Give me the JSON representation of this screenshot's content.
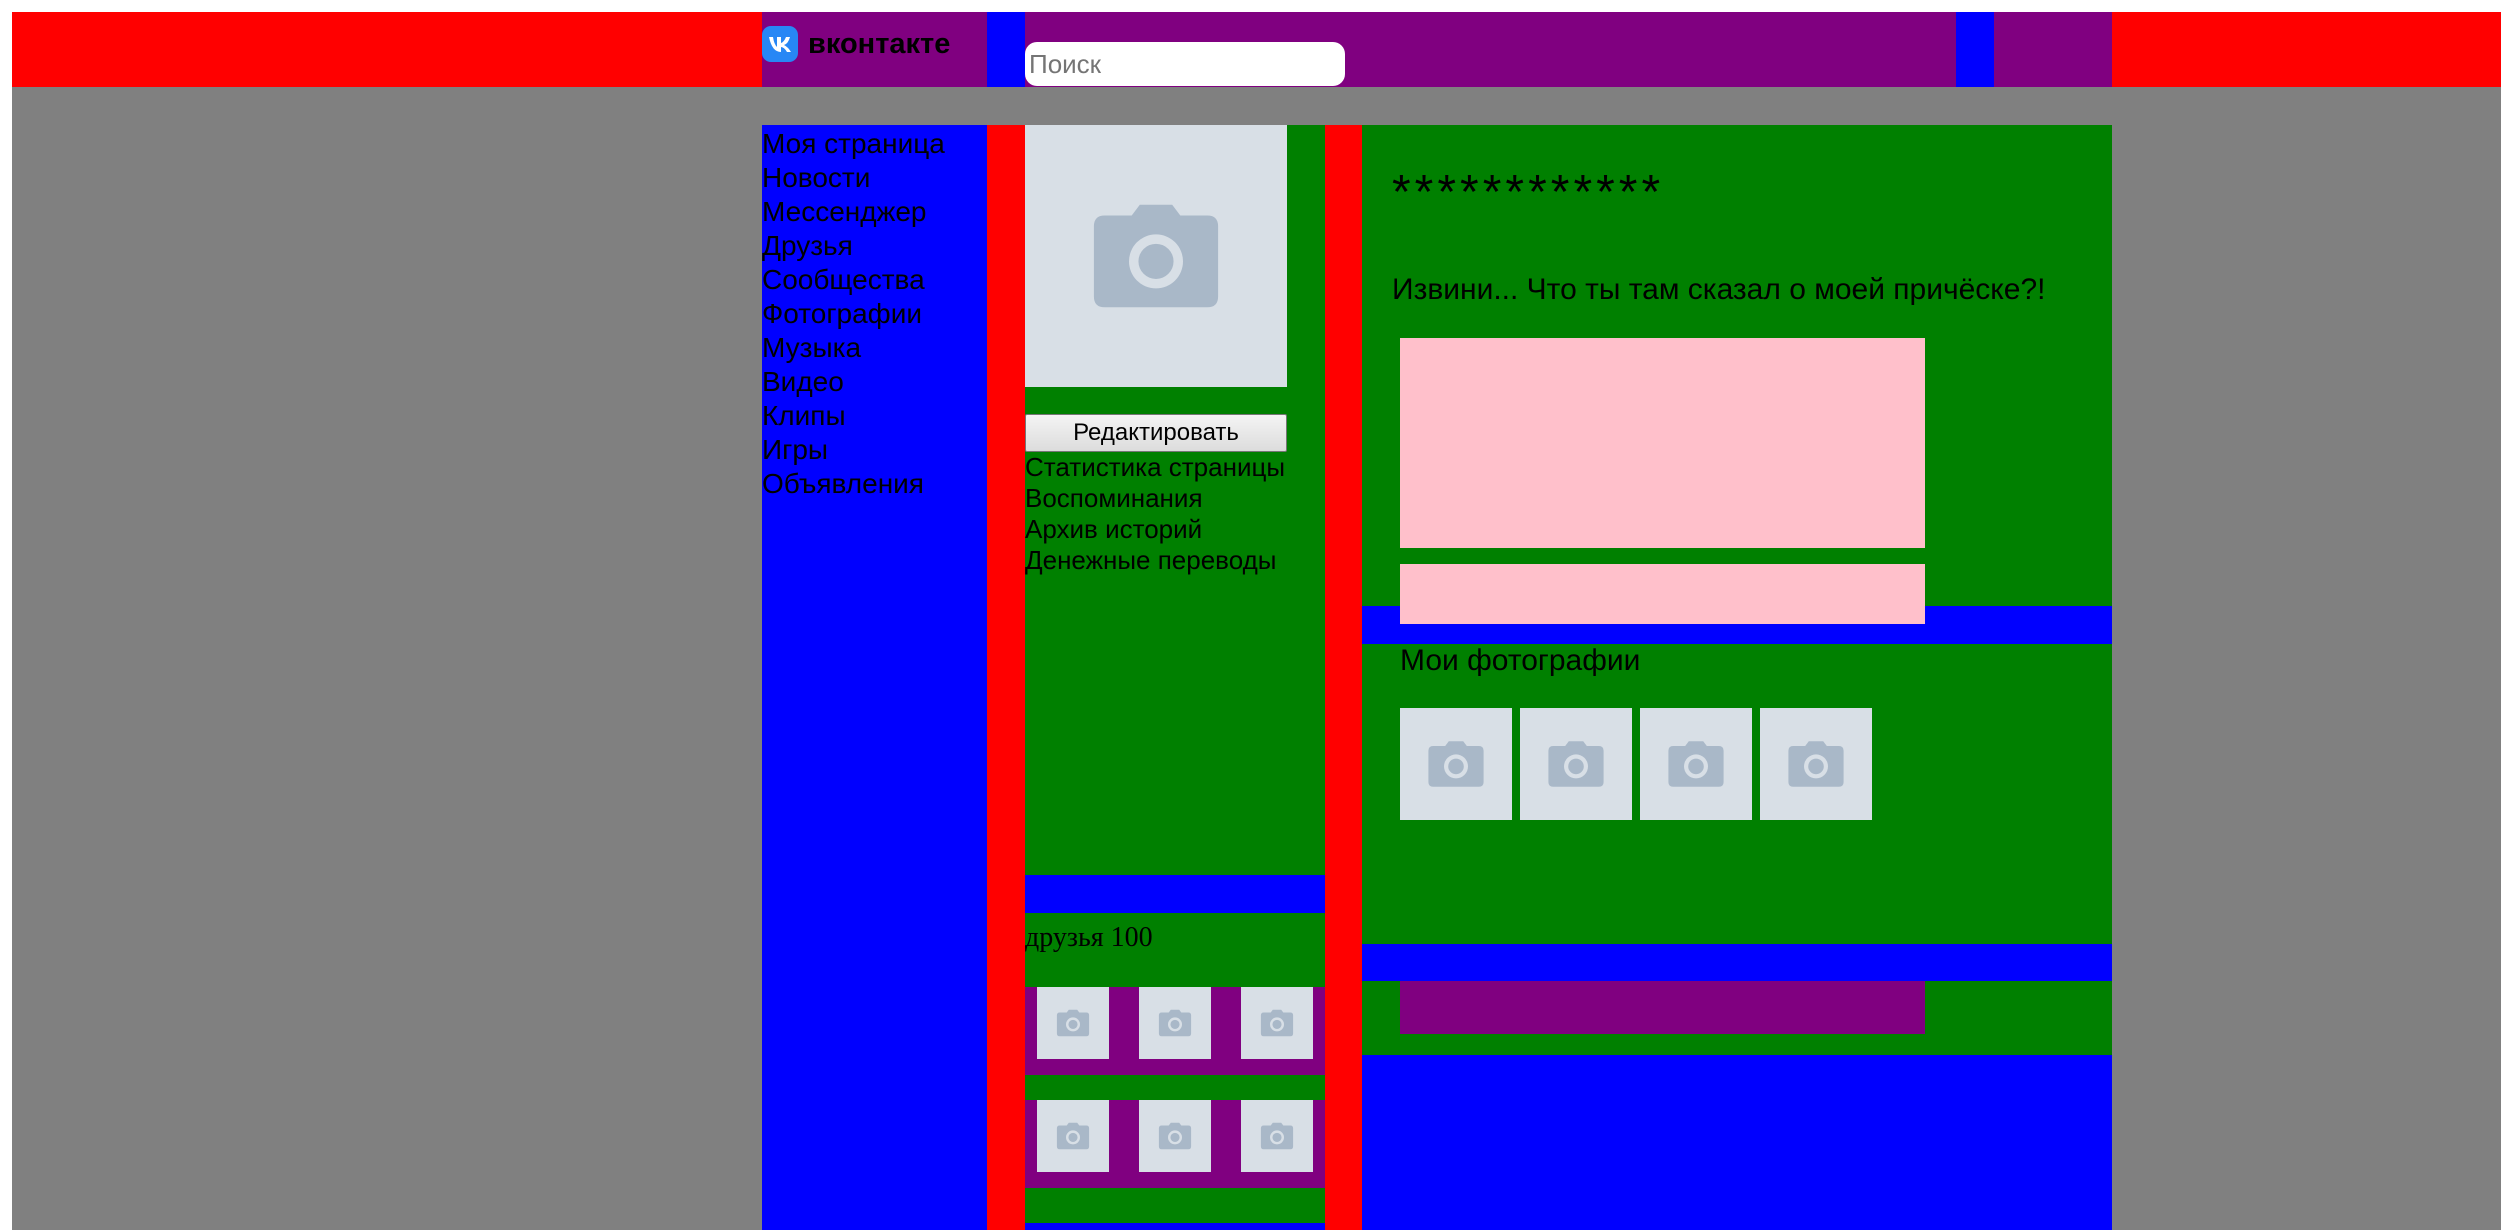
{
  "header": {
    "logo_text": "вконтакте",
    "search": {
      "placeholder": "Поиск",
      "value": ""
    }
  },
  "left_nav": {
    "items": [
      {
        "id": "my-page",
        "label": "Моя страница"
      },
      {
        "id": "news",
        "label": "Новости"
      },
      {
        "id": "messenger",
        "label": "Мессенджер"
      },
      {
        "id": "friends",
        "label": "Друзья"
      },
      {
        "id": "communities",
        "label": "Сообщества"
      },
      {
        "id": "photos",
        "label": "Фотографии"
      },
      {
        "id": "music",
        "label": "Музыка"
      },
      {
        "id": "video",
        "label": "Видео"
      },
      {
        "id": "clips",
        "label": "Клипы"
      },
      {
        "id": "games",
        "label": "Игры"
      },
      {
        "id": "ads",
        "label": "Объявления"
      }
    ]
  },
  "profile_side": {
    "edit_button": "Редактировать",
    "links": [
      {
        "id": "stats",
        "label": "Статистика страницы"
      },
      {
        "id": "memories",
        "label": "Воспоминания"
      },
      {
        "id": "stories-archive",
        "label": "Архив историй"
      },
      {
        "id": "money-transfers",
        "label": "Денежные переводы"
      }
    ],
    "friends_label": "друзья",
    "friends_count": "100"
  },
  "profile_main": {
    "name": "************",
    "status": "Извини... Что ты там сказал о моей причёске?!",
    "photos_title": "Мои фотографии"
  },
  "icons": {
    "logo": "vk-logo-icon",
    "photo_placeholder": "camera-icon"
  },
  "colors": {
    "header": "#ff0000",
    "page_bg": "#808080",
    "nav_bg": "#0000ff",
    "header_block": "#800080",
    "content_bg": "#008000",
    "divider": "#ff0000",
    "info_block": "#ffc0cb",
    "placeholder": "#d8dfe6",
    "camera": "#a9b8c8",
    "vk_blue": "#2787f5"
  }
}
